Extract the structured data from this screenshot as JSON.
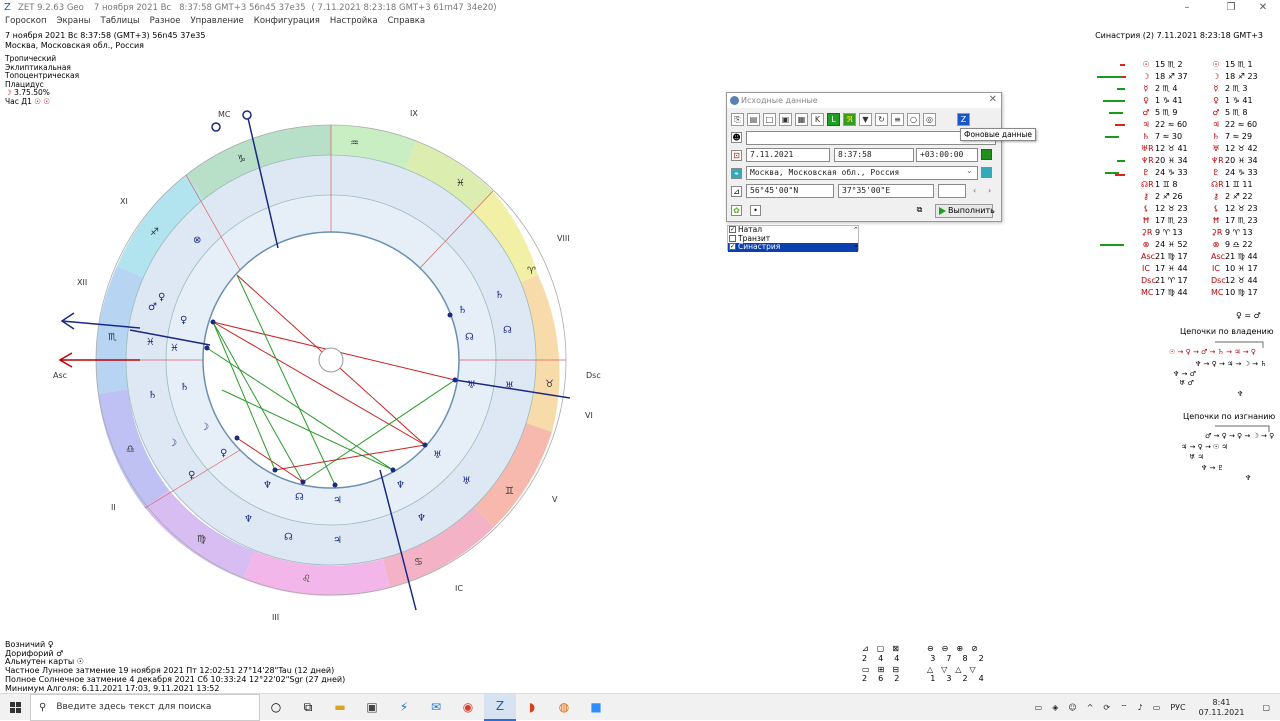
{
  "titlebar": {
    "app": "ZET 9.2.63 Geo",
    "date": "7 ноября 2021  Вс",
    "time": "8:37:58 GMT+3 56n45  37e35",
    "bracket": "( 7.11.2021   8:23:18 GMT+3 61rn47 34e20)"
  },
  "menu": [
    "Гороскоп",
    "Экраны",
    "Таблицы",
    "Разное",
    "Управление",
    "Конфигурация",
    "Настройка",
    "Справка"
  ],
  "header_left": {
    "line1": "7 ноября 2021  Вс   8:37:58 (GMT+3) 56n45  37e35",
    "line2": "Москва, Московская обл., Россия",
    "system": [
      "Тропический",
      "Эклиптикальная",
      "Топоцентрическая",
      "Плацидус"
    ],
    "moon": "3.75.50%",
    "hour": "Час Д1"
  },
  "header_right": "Синастрия (2)  7.11.2021   8:23:18 GMT+3",
  "wheel": {
    "houses": [
      "IX",
      "VIII",
      "VI",
      "V",
      "III",
      "II",
      "XII",
      "XI"
    ],
    "mc": "MC",
    "asc": "Asc",
    "dsc": "Dsc",
    "ic": "IC",
    "signs": [
      "♒",
      "♓",
      "♈",
      "♉",
      "♊",
      "♋",
      "♌",
      "♍",
      "♎",
      "♏",
      "♐",
      "♑"
    ]
  },
  "dialog": {
    "title": "Исходные данные",
    "date": "7.11.2021",
    "time": "8:37:58",
    "tz": "+03:00:00",
    "place": "Москва, Московская обл., Россия",
    "lat": "56°45'00\"N",
    "lon": "37°35'00\"E",
    "run": "Выполнить",
    "tooltip": "Фоновые данные"
  },
  "modes": [
    "Натал",
    "Транзит",
    "Синастрия"
  ],
  "planets": [
    {
      "g1": "☉",
      "v1": "15 ♏ 2",
      "g2": "☉",
      "v2": "15 ♏ 1"
    },
    {
      "g1": "☽",
      "v1": "18 ♐ 37",
      "g2": "☽",
      "v2": "18 ♐ 23"
    },
    {
      "g1": "☿",
      "v1": "2 ♏ 4",
      "g2": "☿",
      "v2": "2 ♏ 3"
    },
    {
      "g1": "♀",
      "v1": "1 ♑ 41",
      "g2": "♀",
      "v2": "1 ♑ 41"
    },
    {
      "g1": "♂",
      "v1": "5 ♏ 9",
      "g2": "♂",
      "v2": "5 ♏ 8"
    },
    {
      "g1": "♃",
      "v1": "22 ≈ 60",
      "g2": "♃",
      "v2": "22 ≈ 60"
    },
    {
      "g1": "♄",
      "v1": "7 ≈ 30",
      "g2": "♄",
      "v2": "7 ≈ 29"
    },
    {
      "g1": "♅R",
      "v1": "12 ♉ 41",
      "g2": "♅",
      "v2": "12 ♉ 42"
    },
    {
      "g1": "♆R",
      "v1": "20 ♓ 34",
      "g2": "♆R",
      "v2": "20 ♓ 34"
    },
    {
      "g1": "♇",
      "v1": "24 ♑ 33",
      "g2": "♇",
      "v2": "24 ♑ 33"
    },
    {
      "g1": "☊R",
      "v1": "1 ♊ 8",
      "g2": "☊R",
      "v2": "1 ♊ 11"
    },
    {
      "g1": "⚷",
      "v1": "2 ♐ 26",
      "g2": "⚷",
      "v2": "2 ♐ 22"
    },
    {
      "g1": "⚸",
      "v1": "12 ♉ 23",
      "g2": "⚸",
      "v2": "12 ♉ 23"
    },
    {
      "g1": "Ħ",
      "v1": "17 ♏ 23",
      "g2": "Ħ",
      "v2": "17 ♏ 23"
    },
    {
      "g1": "⚳R",
      "v1": "9 ♈ 13",
      "g2": "⚳R",
      "v2": "9 ♈ 13"
    },
    {
      "g1": "⊗",
      "v1": "24 ♓ 52",
      "g2": "⊗",
      "v2": "9 ♎ 22"
    },
    {
      "g1": "Asc",
      "v1": "21 ♍ 17",
      "g2": "Asc",
      "v2": "21 ♍ 44"
    },
    {
      "g1": "IC",
      "v1": "17 ♓ 44",
      "g2": "IC",
      "v2": "10 ♓ 17"
    },
    {
      "g1": "Dsc",
      "v1": "21 ♈ 17",
      "g2": "Dsc",
      "v2": "12 ♉ 44"
    },
    {
      "g1": "MC",
      "v1": "17 ♍ 44",
      "g2": "MC",
      "v2": "10 ♍ 17"
    }
  ],
  "chains": {
    "top_formula": "♀ = ♂",
    "rulership": "Цепочки по владению",
    "exile": "Цепочки по изгнанию"
  },
  "bottom": [
    "Возничий  ♀",
    "Дорифорий  ♂",
    "Альмутен карты  ☉",
    "Частное Лунное затмение 19 ноября 2021 Пт 12:02:51 27°14'28\"Tau (12 дней)",
    "Полное Солнечное затмение 4 декабря 2021 Сб 10:33:24 12°22'02\"Sgr (27 дней)",
    "Минимум Алголя: 6.11.2021 17:03,  9.11.2021 13:52"
  ],
  "aspects": {
    "row1": [
      "2",
      "4",
      "4",
      "3",
      "7",
      "8",
      "2"
    ],
    "row2": [
      "2",
      "6",
      "2",
      "1",
      "3",
      "2",
      "4"
    ]
  },
  "taskbar": {
    "search": "Введите здесь текст для поиска",
    "lang": "РУС",
    "time": "8:41",
    "date": "07.11.2021"
  }
}
